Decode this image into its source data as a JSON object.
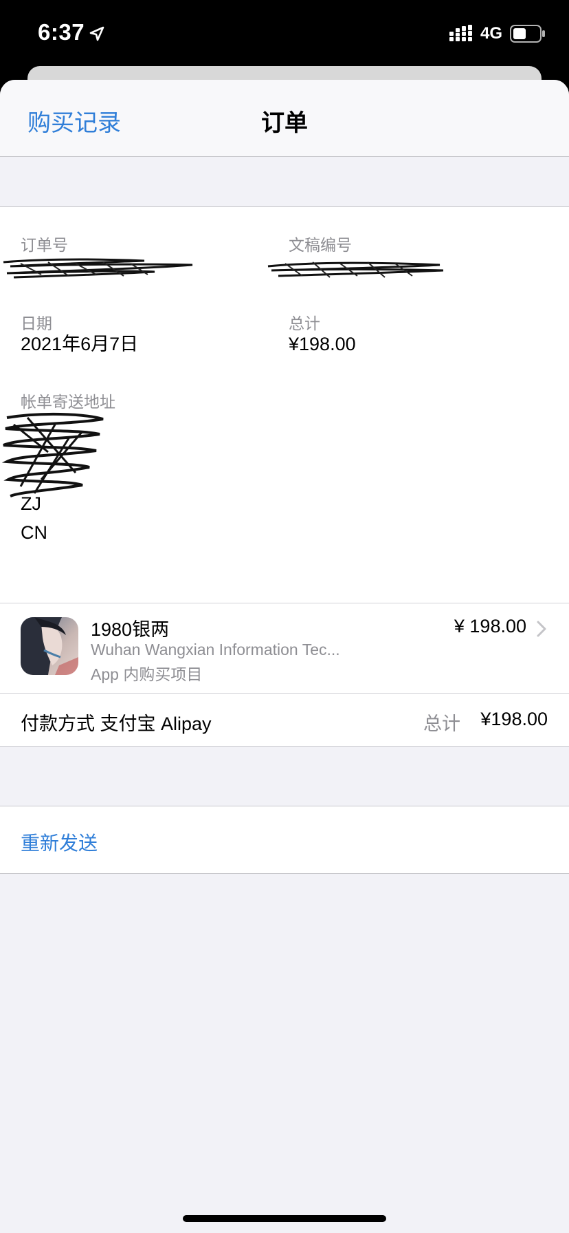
{
  "status_bar": {
    "time": "6:37",
    "network": "4G"
  },
  "nav": {
    "back_label": "购买记录",
    "title": "订单"
  },
  "order": {
    "order_id_label": "订单号",
    "document_id_label": "文稿编号",
    "date_label": "日期",
    "date_value": "2021年6月7日",
    "total_label": "总计",
    "total_value": "¥198.00",
    "billing_address_label": "帐单寄送地址",
    "address_lines": [
      "ZJ",
      "CN"
    ]
  },
  "item": {
    "name": "1980银两",
    "developer": "Wuhan Wangxian Information Tec...",
    "type": "App 内购买项目",
    "price": "¥ 198.00"
  },
  "payment": {
    "method": "付款方式 支付宝 Alipay",
    "total_label": "总计",
    "total_value": "¥198.00"
  },
  "actions": {
    "resend_label": "重新发送"
  },
  "colors": {
    "link_blue": "#2f7ed8",
    "secondary_gray": "#8e8e93",
    "background_gray": "#f2f2f7"
  },
  "icons": [
    "location-arrow-icon",
    "signal-bars-icon",
    "battery-icon",
    "chevron-right-icon",
    "app-icon"
  ]
}
